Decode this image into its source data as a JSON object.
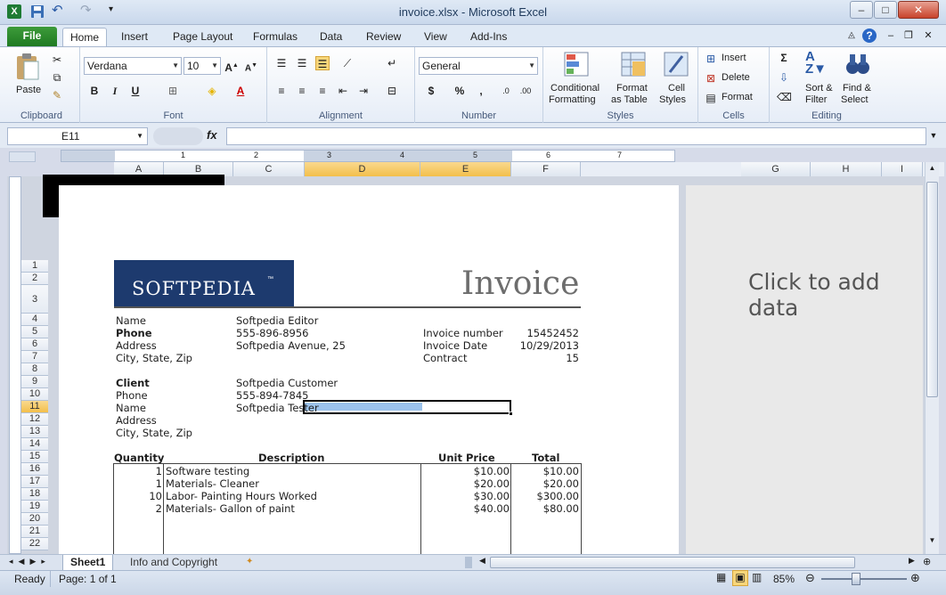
{
  "window": {
    "title": "invoice.xlsx  -  Microsoft Excel",
    "minimize": "–",
    "maximize": "□",
    "close": "✕"
  },
  "tabs": [
    "File",
    "Home",
    "Insert",
    "Page Layout",
    "Formulas",
    "Data",
    "Review",
    "View",
    "Add-Ins"
  ],
  "ribbon": {
    "clipboard": {
      "label": "Clipboard",
      "paste": "Paste"
    },
    "font": {
      "label": "Font",
      "name": "Verdana",
      "size": "10",
      "bold": "B",
      "italic": "I",
      "underline": "U"
    },
    "alignment": {
      "label": "Alignment"
    },
    "number": {
      "label": "Number",
      "format": "General",
      "currency": "$",
      "percent": "%",
      "comma": ","
    },
    "styles": {
      "label": "Styles",
      "conditional": "Conditional",
      "formatting": "Formatting",
      "format_as": "Format",
      "as_table": "as Table",
      "cell": "Cell",
      "cell_styles": "Styles"
    },
    "cells": {
      "label": "Cells",
      "insert": "Insert",
      "delete": "Delete",
      "format": "Format"
    },
    "editing": {
      "label": "Editing",
      "sort": "Sort &",
      "filter": "Filter",
      "find": "Find &",
      "select": "Select"
    }
  },
  "formula_bar": {
    "name_box": "E11",
    "fx": "fx",
    "value": ""
  },
  "ruler_marks": [
    "1",
    "2",
    "3",
    "4",
    "5",
    "6",
    "7"
  ],
  "columns": [
    "A",
    "B",
    "C",
    "D",
    "E",
    "F",
    "G",
    "H",
    "I"
  ],
  "rows": [
    "1",
    "2",
    "3",
    "4",
    "5",
    "6",
    "7",
    "8",
    "9",
    "10",
    "11",
    "12",
    "13",
    "14",
    "15",
    "16",
    "17",
    "18",
    "19",
    "20",
    "21",
    "22"
  ],
  "invoice": {
    "logo": "SOFTPEDIA",
    "logo_tm": "™",
    "title": "Invoice",
    "name_label": "Name",
    "name_value": "Softpedia Editor",
    "phone_label": "Phone",
    "phone_value": "555-896-8956",
    "address_label": "Address",
    "address_value": "Softpedia Avenue, 25",
    "city_label": "City, State, Zip",
    "invoice_number_label": "Invoice number",
    "invoice_number": "15452452",
    "invoice_date_label": "Invoice Date",
    "invoice_date": "10/29/2013",
    "contract_label": "Contract",
    "contract": "15",
    "client_label": "Client",
    "client_value": "Softpedia Customer",
    "client_phone_label": "Phone",
    "client_phone": "555-894-7845",
    "client_name_label": "Name",
    "client_name": "Softpedia Tester",
    "client_address_label": "Address",
    "client_city_label": "City, State, Zip",
    "headers": {
      "qty": "Quantity",
      "desc": "Description",
      "price": "Unit Price",
      "total": "Total"
    },
    "items": [
      {
        "qty": "1",
        "desc": "Software testing",
        "price": "$10.00",
        "total": "$10.00"
      },
      {
        "qty": "1",
        "desc": "Materials- Cleaner",
        "price": "$20.00",
        "total": "$20.00"
      },
      {
        "qty": "10",
        "desc": "Labor- Painting Hours Worked",
        "price": "$30.00",
        "total": "$300.00"
      },
      {
        "qty": "2",
        "desc": "Materials- Gallon of paint",
        "price": "$40.00",
        "total": "$80.00"
      }
    ]
  },
  "side_page": {
    "placeholder": "Click to add data"
  },
  "sheets": [
    "Sheet1",
    "Info and Copyright"
  ],
  "status": {
    "ready": "Ready",
    "page": "Page: 1 of 1",
    "zoom": "85%"
  }
}
